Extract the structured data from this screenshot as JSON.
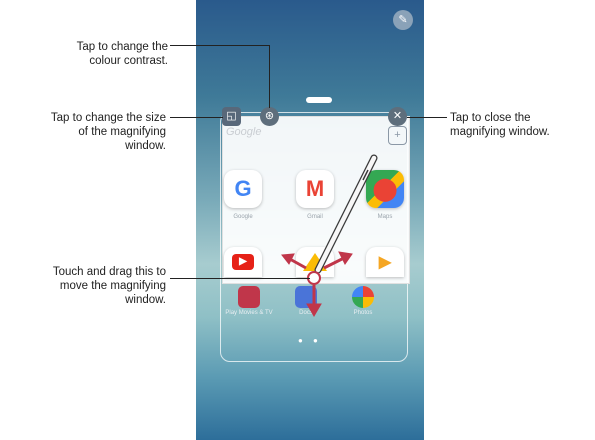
{
  "callouts": {
    "contrast": "Tap to change the\ncolour contrast.",
    "size": "Tap to change the size\nof the magnifying\nwindow.",
    "drag": "Touch and drag this to\nmove the magnifying\nwindow.",
    "close": "Tap to close the\nmagnifying window."
  },
  "magnifier": {
    "widget_label": "Google",
    "apps": [
      {
        "name": "Google",
        "icon": "google-icon",
        "color": "#4285F4"
      },
      {
        "name": "Gmail",
        "icon": "gmail-icon",
        "color": "#EA4335"
      },
      {
        "name": "Maps",
        "icon": "maps-icon",
        "color": "#34A853"
      }
    ],
    "row2_icons": [
      "youtube-icon",
      "drive-icon",
      "play-movies-icon"
    ]
  },
  "screen_apps": [
    {
      "name": "Play Movies & TV",
      "icon": "play-movies-icon"
    },
    {
      "name": "Docs",
      "icon": "docs-icon"
    },
    {
      "name": "Photos",
      "icon": "photos-icon"
    }
  ],
  "colors": {
    "arrow": "#c0364a",
    "button": "#5e6e7c"
  }
}
